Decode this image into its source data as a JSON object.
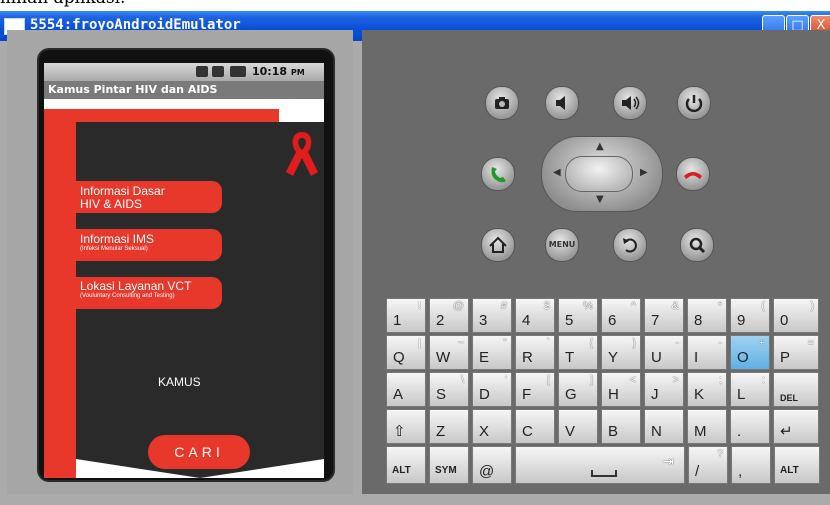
{
  "doc_text": "mnan aplikasi.",
  "window": {
    "title": "5554:froyoAndroidEmulator",
    "controls": [
      "_",
      "□",
      "X"
    ]
  },
  "device": {
    "status_time": "10:18",
    "status_ampm": "PM",
    "app_title": "Kamus Pintar HIV dan AIDS",
    "menu": [
      {
        "line1": "Informasi Dasar",
        "line2": "HIV & AIDS"
      },
      {
        "line1": "Informasi IMS",
        "line2": "(Infeksi Menular Seksual)"
      },
      {
        "line1": "Lokasi Layanan VCT",
        "line2": "(Vouluntary Consulting and Testing)"
      }
    ],
    "kamus_label": "KAMUS",
    "cari_label": "CARI"
  },
  "controls": {
    "menu_label": "MENU"
  },
  "keyboard": {
    "row1": [
      [
        "1",
        "!"
      ],
      [
        "2",
        "@"
      ],
      [
        "3",
        "#"
      ],
      [
        "4",
        "$"
      ],
      [
        "5",
        "%"
      ],
      [
        "6",
        "^"
      ],
      [
        "7",
        "&"
      ],
      [
        "8",
        "*"
      ],
      [
        "9",
        "("
      ],
      [
        "0",
        ")"
      ]
    ],
    "row2": [
      [
        "Q",
        "|"
      ],
      [
        "W",
        "~"
      ],
      [
        "E",
        "\""
      ],
      [
        "R",
        "`"
      ],
      [
        "T",
        "{"
      ],
      [
        "Y",
        "}"
      ],
      [
        "U",
        "-"
      ],
      [
        "I",
        "-"
      ],
      [
        "O",
        "+"
      ],
      [
        "P",
        "="
      ]
    ],
    "row3": [
      [
        "A",
        ""
      ],
      [
        "S",
        "\\"
      ],
      [
        "D",
        "'"
      ],
      [
        "F",
        "["
      ],
      [
        "G",
        "]"
      ],
      [
        "H",
        "<"
      ],
      [
        "J",
        ">"
      ],
      [
        "K",
        ";"
      ],
      [
        "L",
        ":"
      ],
      [
        "DEL",
        ""
      ]
    ],
    "row4": [
      [
        "⇧",
        ""
      ],
      [
        "Z",
        ""
      ],
      [
        "X",
        ""
      ],
      [
        "C",
        ""
      ],
      [
        "V",
        ""
      ],
      [
        "B",
        ""
      ],
      [
        "N",
        ""
      ],
      [
        "M",
        ""
      ],
      [
        ".",
        ""
      ],
      [
        "↵",
        ""
      ]
    ],
    "row5": {
      "alt_left": "ALT",
      "sym": "SYM",
      "at": "@",
      "slash": "/",
      "slash_alt": "?",
      "comma": ",",
      "alt_right": "ALT"
    }
  }
}
